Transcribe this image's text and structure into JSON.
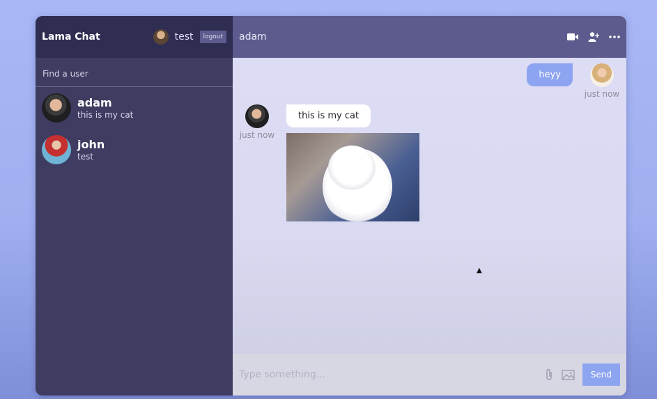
{
  "app": {
    "title": "Lama Chat"
  },
  "current_user": {
    "name": "test",
    "logout_label": "logout"
  },
  "search": {
    "placeholder": "Find a user"
  },
  "chats": [
    {
      "name": "adam",
      "last_message": "this is my cat"
    },
    {
      "name": "john",
      "last_message": "test"
    }
  ],
  "chat_header": {
    "title": "adam",
    "icons": [
      "video-camera-icon",
      "add-user-icon",
      "more-icon"
    ]
  },
  "messages": [
    {
      "owner": true,
      "text": "heyy",
      "time": "just now"
    },
    {
      "owner": false,
      "text": "this is my cat",
      "time": "just now",
      "has_image": true
    }
  ],
  "composer": {
    "placeholder": "Type something...",
    "send_label": "Send",
    "icons": [
      "attach-icon",
      "image-icon"
    ]
  },
  "colors": {
    "accent": "#8da4f1",
    "sidebar": "#3e3c61",
    "navbar": "#2f2d52",
    "chat_header": "#5d5b8d"
  }
}
